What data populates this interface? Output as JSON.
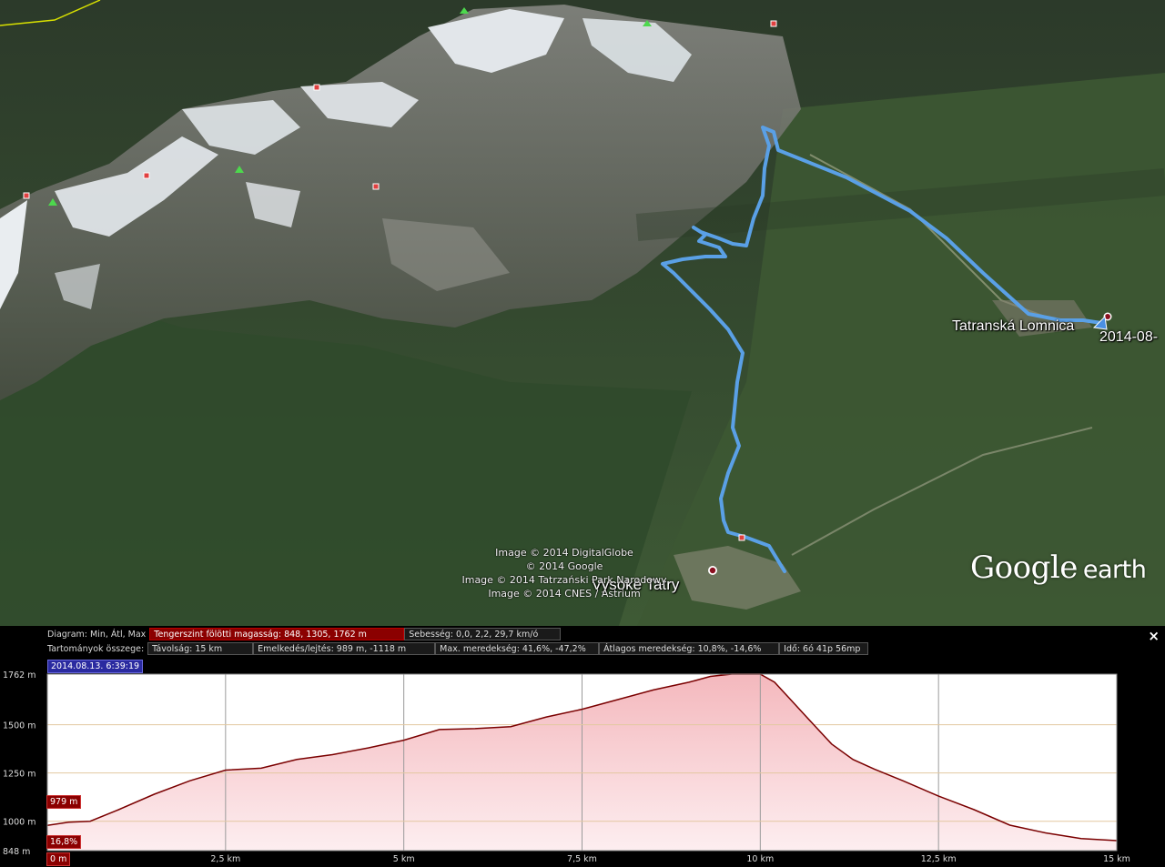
{
  "map": {
    "attribution": [
      "Image © 2014 DigitalGlobe",
      "© 2014 Google",
      "Image © 2014 Tatrzański Park Narodowy",
      "Image © 2014 CNES / Astrium"
    ],
    "places": {
      "town_east": "Tatranská Lomnica",
      "track_end_label": "2014-08-",
      "town_south": "Vysoké Tatry"
    },
    "brand": {
      "google": "Google",
      "earth": "earth"
    },
    "track_color": "#5aa0e6"
  },
  "profile": {
    "row1_label": "Diagram: Min, Átl, Max",
    "elevation_tab": "Tengerszint fölötti magasság: 848, 1305, 1762 m",
    "speed_tab": "Sebesség: 0,0, 2,2, 29,7 km/ó",
    "row2_label": "Tartományok összege:",
    "distance": "Távolság: 15 km",
    "gain_loss": "Emelkedés/lejtés: 989 m, -1118 m",
    "max_slope": "Max. meredekség: 41,6%, -47,2%",
    "avg_slope": "Átlagos meredekség: 10,8%, -14,6%",
    "time": "Idő: 6ó 41p 56mp",
    "date_stamp": "2014.08.13. 6:39:19",
    "close_label": "×",
    "cursor_elevation": "979 m",
    "cursor_slope": "16,8%",
    "cursor_distance": "0 m",
    "line_color": "#7a0000",
    "fill_color": "#f4b8bd"
  },
  "chart_data": {
    "type": "area",
    "xlabel": "",
    "ylabel": "",
    "x_ticks": [
      "0 m",
      "2,5 km",
      "5 km",
      "7,5 km",
      "10 km",
      "12,5 km",
      "15 km"
    ],
    "y_ticks": [
      "848 m",
      "1000 m",
      "1250 m",
      "1500 m",
      "1762 m"
    ],
    "y_tick_values": [
      848,
      1000,
      1250,
      1500,
      1762
    ],
    "xlim": [
      0,
      15
    ],
    "ylim": [
      848,
      1762
    ],
    "x_unit": "km",
    "y_unit": "m",
    "grid": true,
    "series": [
      {
        "x": [
          0,
          0.3,
          0.6,
          1.0,
          1.5,
          2.0,
          2.5,
          3.0,
          3.5,
          4.0,
          4.5,
          5.0,
          5.5,
          6.0,
          6.5,
          7.0,
          7.5,
          8.0,
          8.5,
          9.0,
          9.3,
          9.6,
          10.0,
          10.2,
          10.4,
          10.6,
          10.8,
          11.0,
          11.3,
          11.6,
          12.0,
          12.5,
          13.0,
          13.5,
          14.0,
          14.5,
          15.0
        ],
        "y": [
          979,
          995,
          1000,
          1060,
          1140,
          1210,
          1265,
          1275,
          1320,
          1345,
          1380,
          1420,
          1475,
          1480,
          1490,
          1540,
          1580,
          1630,
          1680,
          1720,
          1750,
          1762,
          1762,
          1720,
          1640,
          1560,
          1480,
          1400,
          1320,
          1270,
          1210,
          1130,
          1060,
          980,
          940,
          910,
          900
        ]
      }
    ]
  }
}
